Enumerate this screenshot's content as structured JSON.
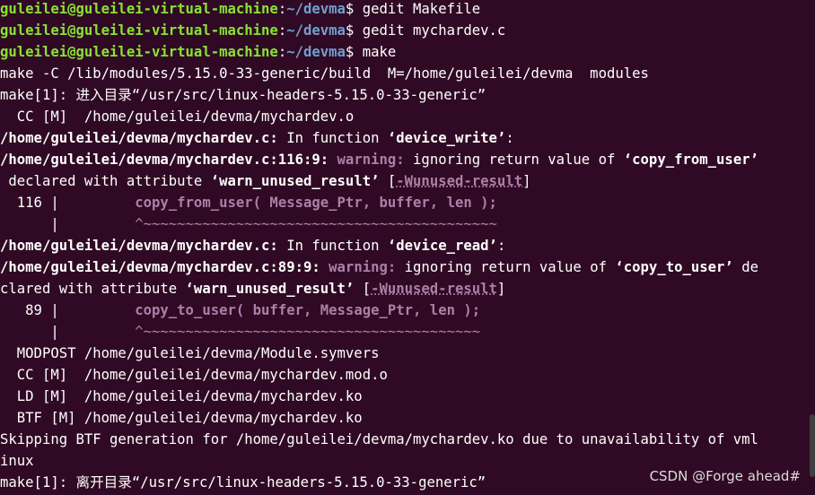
{
  "terminal": {
    "prompt": {
      "user_host": "guleilei@guleilei-virtual-machine",
      "colon": ":",
      "path": "~/devma",
      "dollar": "$ "
    },
    "commands": [
      "gedit Makefile",
      "gedit mychardev.c",
      "make"
    ],
    "lines": {
      "l3": "make -C /lib/modules/5.15.0-33-generic/build  M=/home/guleilei/devma  modules",
      "l4": "make[1]: 进入目录“/usr/src/linux-headers-5.15.0-33-generic”",
      "l5": "  CC [M]  /home/guleilei/devma/mychardev.o",
      "l6_a": "/home/guleilei/devma/mychardev.c:",
      "l6_b": " In function ",
      "l6_c": "‘device_write’",
      "l6_d": ":",
      "l7_a": "/home/guleilei/devma/mychardev.c:116:9:",
      "l7_b": " ",
      "l7_c": "warning:",
      "l7_d": " ignoring return value of ",
      "l7_e": "‘copy_from_user’",
      "l8_a": " declared with attribute ",
      "l8_b": "‘warn_unused_result’",
      "l8_c": " [",
      "l8_d": "-Wunused-result",
      "l8_e": "]",
      "l9_a": "  116 |         ",
      "l9_b": "copy_from_user( Message_Ptr, buffer, len );",
      "l10_a": "      |         ",
      "l10_b": "^~~~~~~~~~~~~~~~~~~~~~~~~~~~~~~~~~~~~~~~~~~",
      "l11_a": "/home/guleilei/devma/mychardev.c:",
      "l11_b": " In function ",
      "l11_c": "‘device_read’",
      "l11_d": ":",
      "l12_a": "/home/guleilei/devma/mychardev.c:89:9:",
      "l12_b": " ",
      "l12_c": "warning:",
      "l12_d": " ignoring return value of ",
      "l12_e": "‘copy_to_user’",
      "l12_f": " de",
      "l13_a": "clared with attribute ",
      "l13_b": "‘warn_unused_result’",
      "l13_c": " [",
      "l13_d": "-Wunused-result",
      "l13_e": "]",
      "l14_a": "   89 |         ",
      "l14_b": "copy_to_user( buffer, Message_Ptr, len );",
      "l15_a": "      |         ",
      "l15_b": "^~~~~~~~~~~~~~~~~~~~~~~~~~~~~~~~~~~~~~~~~",
      "l16": "  MODPOST /home/guleilei/devma/Module.symvers",
      "l17": "  CC [M]  /home/guleilei/devma/mychardev.mod.o",
      "l18": "  LD [M]  /home/guleilei/devma/mychardev.ko",
      "l19": "  BTF [M] /home/guleilei/devma/mychardev.ko",
      "l20": "Skipping BTF generation for /home/guleilei/devma/mychardev.ko due to unavailability of vml",
      "l21": "inux",
      "l22": "make[1]: 离开目录“/usr/src/linux-headers-5.15.0-33-generic”"
    }
  },
  "watermark": "CSDN @Forge ahead#",
  "colors": {
    "background": "#300a24",
    "user_host": "#8ae234",
    "path": "#729fcf",
    "warning": "#ad7fa8",
    "text": "#ffffff"
  }
}
